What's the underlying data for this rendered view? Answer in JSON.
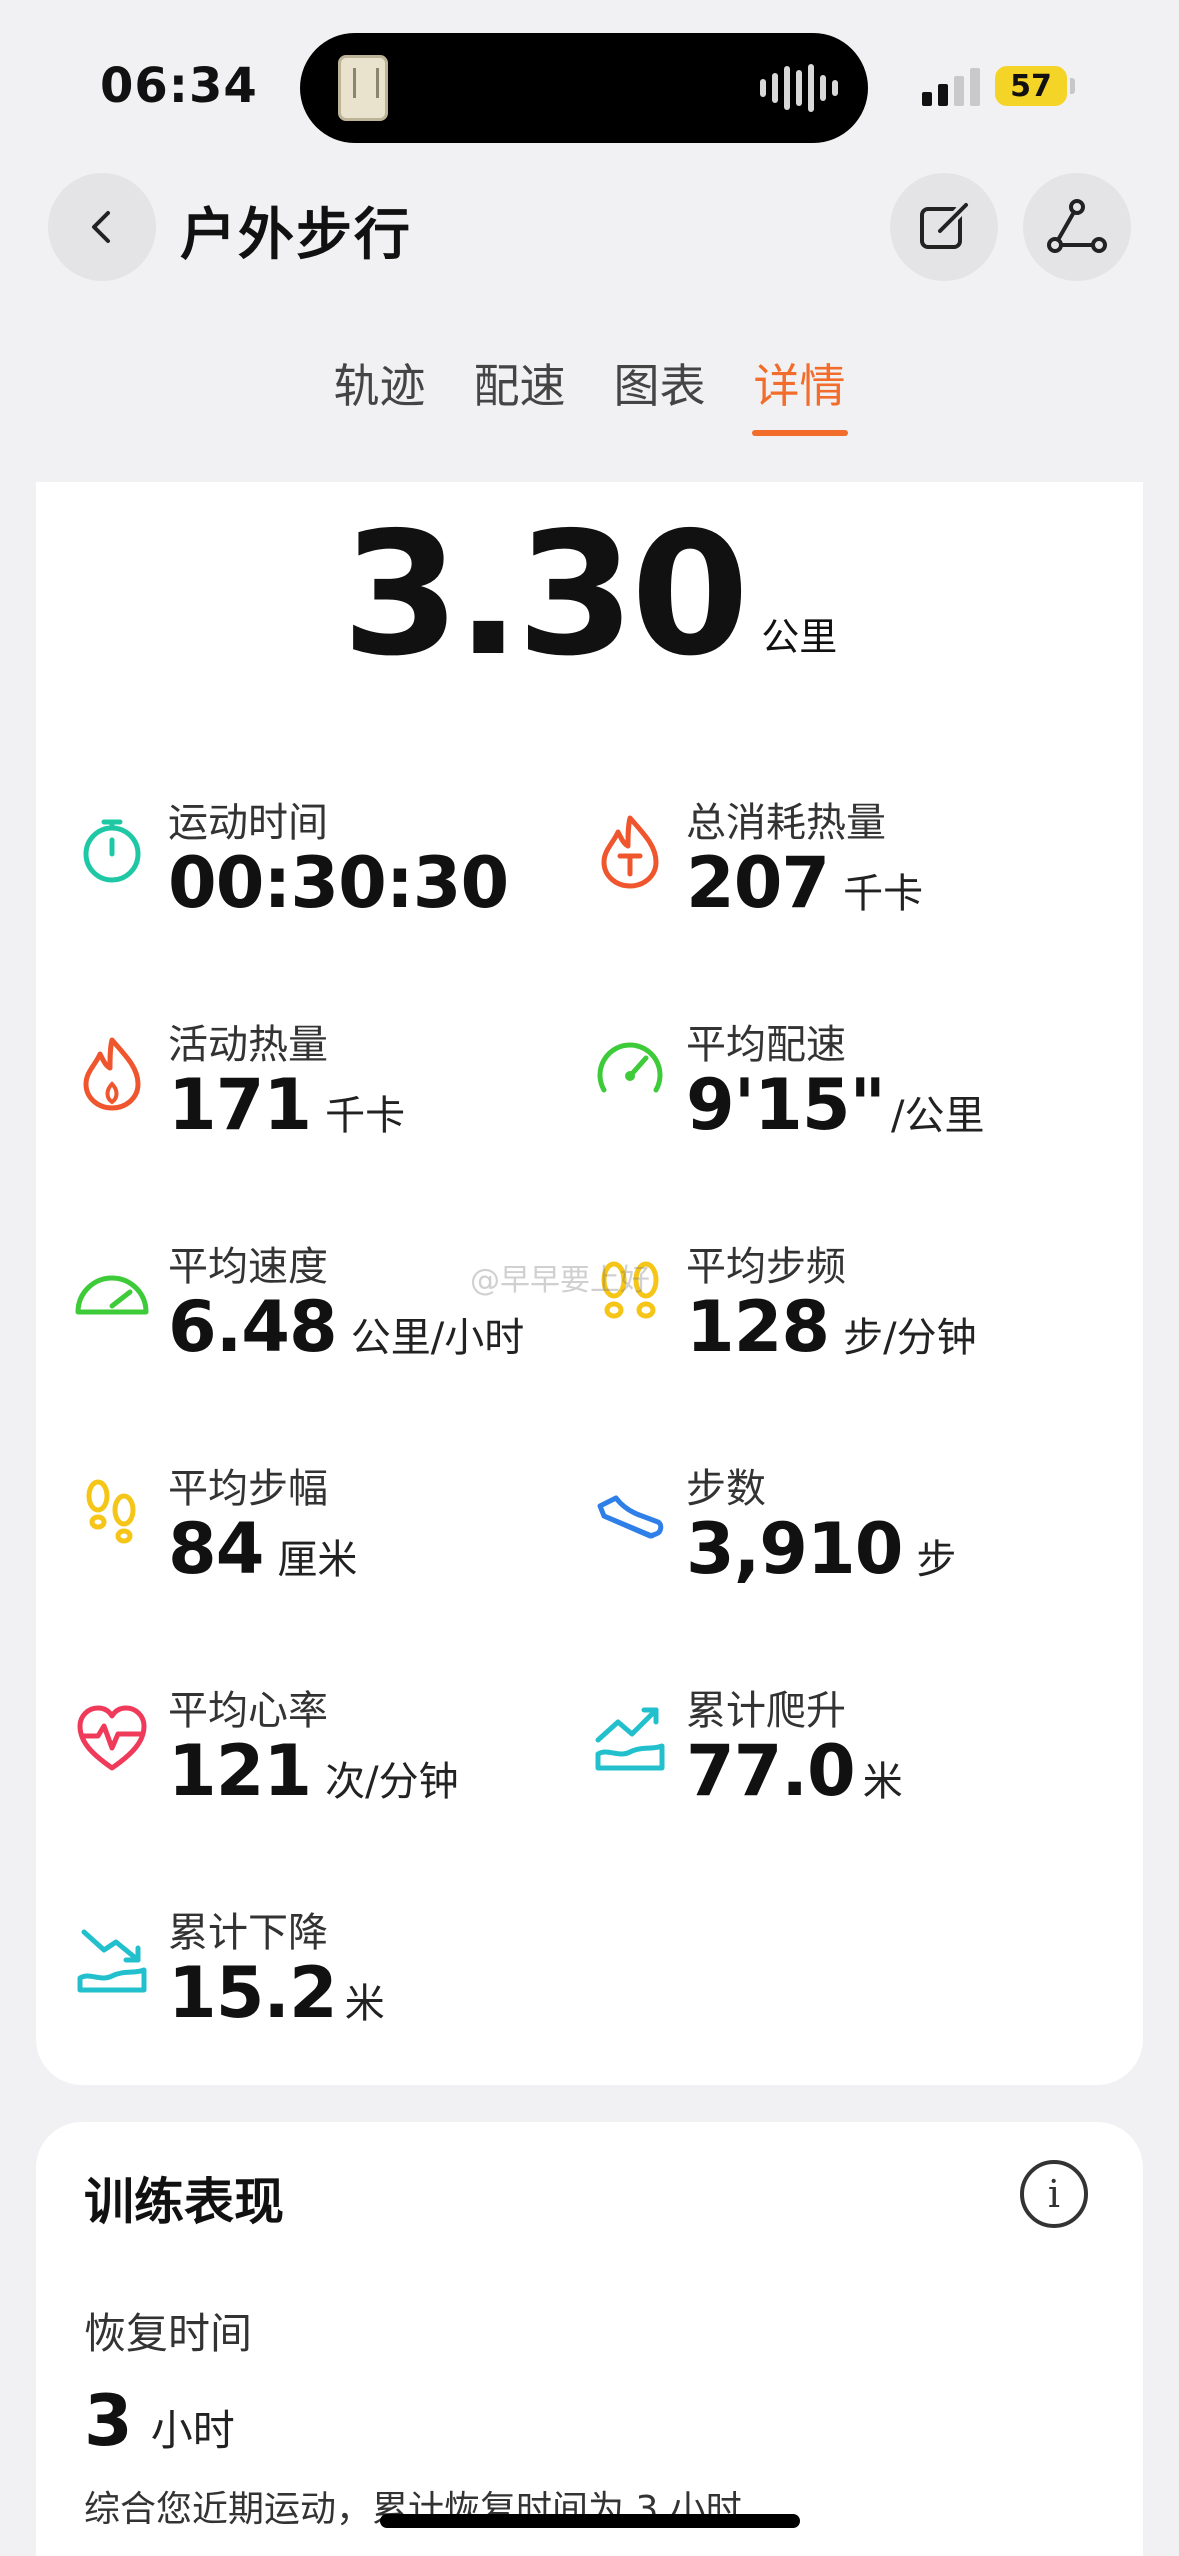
{
  "status_bar": {
    "time": "06:34",
    "battery": "57"
  },
  "header": {
    "title": "户外步行"
  },
  "tabs": [
    {
      "label": "轨迹",
      "active": false
    },
    {
      "label": "配速",
      "active": false
    },
    {
      "label": "图表",
      "active": false
    },
    {
      "label": "详情",
      "active": true
    }
  ],
  "summary": {
    "distance": "3.30",
    "distance_unit": "公里"
  },
  "metrics": {
    "duration": {
      "label": "运动时间",
      "value": "00:30:30",
      "unit": "",
      "icon": "stopwatch-icon",
      "color": "#1fc8a4"
    },
    "total_calories": {
      "label": "总消耗热量",
      "value": "207",
      "unit": "千卡",
      "icon": "flame-total-icon",
      "color": "#f0562d"
    },
    "active_calories": {
      "label": "活动热量",
      "value": "171",
      "unit": "千卡",
      "icon": "flame-icon",
      "color": "#f0562d"
    },
    "avg_pace": {
      "label": "平均配速",
      "value": "9'15\"",
      "unit": "/公里",
      "icon": "pace-gauge-icon",
      "color": "#3ecb3a"
    },
    "avg_speed": {
      "label": "平均速度",
      "value": "6.48",
      "unit": "公里/小时",
      "icon": "speedometer-icon",
      "color": "#3ecb3a"
    },
    "avg_cadence": {
      "label": "平均步频",
      "value": "128",
      "unit": "步/分钟",
      "icon": "footprints-icon",
      "color": "#f5c518"
    },
    "avg_stride": {
      "label": "平均步幅",
      "value": "84",
      "unit": "厘米",
      "icon": "footprints-icon",
      "color": "#f5c518"
    },
    "steps": {
      "label": "步数",
      "value": "3,910",
      "unit": "步",
      "icon": "shoe-icon",
      "color": "#2f7fe8"
    },
    "avg_heart_rate": {
      "label": "平均心率",
      "value": "121",
      "unit": "次/分钟",
      "icon": "heart-rate-icon",
      "color": "#f03a5a"
    },
    "total_ascent": {
      "label": "累计爬升",
      "value": "77.0",
      "unit": "米",
      "icon": "ascent-icon",
      "color": "#22c0cc"
    },
    "total_descent": {
      "label": "累计下降",
      "value": "15.2",
      "unit": "米",
      "icon": "descent-icon",
      "color": "#22c0cc"
    }
  },
  "watermark": "@早早要上好",
  "training": {
    "title": "训练表现",
    "info_icon": "info-icon",
    "recovery_label": "恢复时间",
    "recovery_value": "3",
    "recovery_unit": "小时",
    "description": "综合您近期运动，累计恢复时间为 3 小时"
  }
}
